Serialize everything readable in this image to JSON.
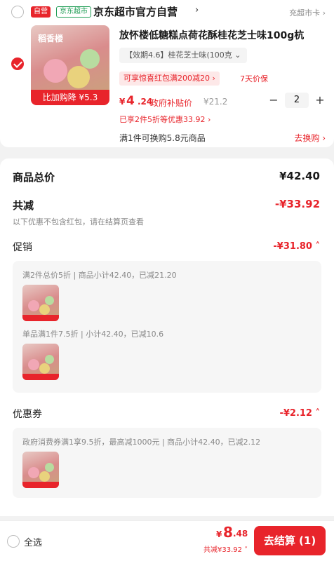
{
  "store": {
    "self_badge": "自营",
    "jd_badge": "京东超市",
    "name": "京东超市官方自营",
    "chevron": "›",
    "right_text": "充超市卡 ›"
  },
  "product": {
    "thumb_brand": "稻香楼",
    "thumb_tag": "比加购降 ¥5.3",
    "title": "放怀楼低糖糕点荷花酥桂花芝士味100g杭",
    "spec": "【效期4.6】桂花芝士味(100克 ⌄",
    "coupon": "可享惊喜红包满200减20 ›",
    "days": "7天价保",
    "price_yen": "¥",
    "price_int": "4",
    "price_dec": ".24",
    "gov_tag": "政府补贴价",
    "orig_price": "¥21.2",
    "promo_line": "已享2件5折等优惠33.92 ›",
    "swap_line": "满1件可换购5.8元商品",
    "swap_link": "去换购 ›"
  },
  "stepper": {
    "minus": "−",
    "value": "2",
    "plus": "+"
  },
  "summary": {
    "total_label": "商品总价",
    "total_value": "¥42.40",
    "discount_label": "共减",
    "discount_value": "-¥33.92",
    "discount_note": "以下优惠不包含红包，请在结算页查看",
    "promo_title": "促销",
    "promo_amount": "-¥31.80 ˄",
    "promo_detail_1": "满2件总价5折 | 商品小计42.40，已减21.20",
    "promo_detail_2": "单品满1件7.5折 | 小计42.40，已减10.6",
    "coupon_title": "优惠券",
    "coupon_amount": "-¥2.12 ˄",
    "coupon_detail": "政府消费券满1享9.5折，最高减1000元 | 商品小计42.40，已减2.12"
  },
  "bottom": {
    "select_all": "全选",
    "total_yen": "¥",
    "total_int": "8",
    "total_dec": ".48",
    "total_saved": "共减¥33.92 ˅",
    "checkout": "去结算 (1)"
  },
  "colors": {
    "accent": "#e8242b",
    "jd_green": "#1f9d55"
  },
  "icons": {
    "check": "checkmark-icon",
    "chevron": "chevron-right-icon"
  }
}
